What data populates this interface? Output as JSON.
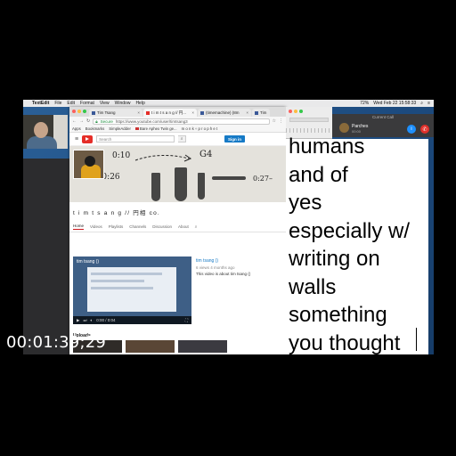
{
  "menubar": {
    "app": "TextEdit",
    "items": [
      "File",
      "Edit",
      "Format",
      "View",
      "Window",
      "Help"
    ],
    "clock": "Wed Feb 22  15:58:33",
    "battery": "72%"
  },
  "browser": {
    "tabs": [
      {
        "label": "Tim Tsang",
        "icon": "facebook-icon"
      },
      {
        "label": "t i m t s a n g // 円...",
        "icon": "youtube-icon"
      },
      {
        "label": "(timemachine) (8m",
        "icon": "facebook-icon"
      },
      {
        "label": "Tim",
        "icon": "facebook-icon"
      }
    ],
    "secure_label": "Secure",
    "url": "https://www.youtube.com/user/timtsang3",
    "bookmarks": [
      "Apps",
      "Bookmarks",
      "SimpleAdder",
      "Bare Aphex Twin ge...",
      "m o n k ÷ p r o p h e t"
    ]
  },
  "youtube": {
    "search_placeholder": "Search",
    "signin_label": "Sign in",
    "channel_name": "t i m t s a n g // 円相 co.",
    "tabs": [
      "Home",
      "Videos",
      "Playlists",
      "Channels",
      "Discussion",
      "About"
    ],
    "active_tab": "Home",
    "banner_notes": {
      "a": "0:10",
      "b": "G4",
      "c": "0:10 – 0:26",
      "d": "0:27–"
    },
    "featured": {
      "title": "tim tsang ()",
      "meta": "6 views  4 months ago",
      "desc": "This video is about tim tsang ()",
      "player_title": "tim tsang ()",
      "time": "0:00 / 0:04"
    },
    "uploads_label": "Uploads"
  },
  "call": {
    "header": "Current Call",
    "name": "Parches",
    "elapsed": "00:00"
  },
  "textedit": {
    "lines": [
      "humans",
      "and of",
      "yes",
      "especially w/",
      "writing on",
      "walls",
      "something",
      "you thought"
    ]
  },
  "timecode": "00:01:39;29",
  "colors": {
    "youtube_red": "#e52d27",
    "signin_blue": "#167ac6",
    "end_call_red": "#e0302a",
    "mute_blue": "#1e90ff"
  }
}
